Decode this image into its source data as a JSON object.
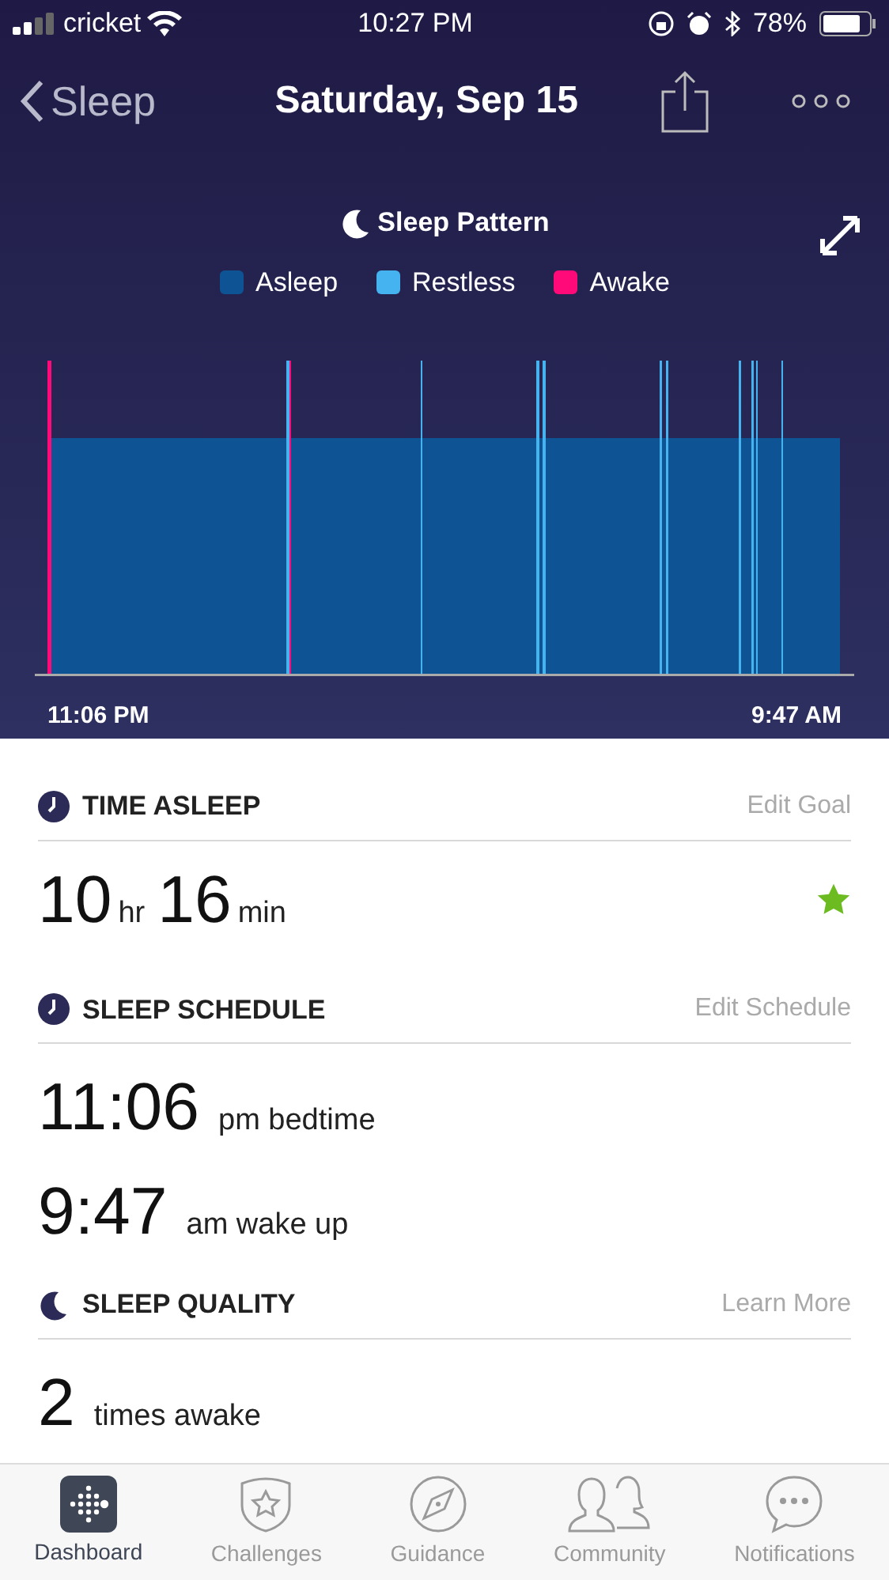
{
  "status_bar": {
    "carrier": "cricket",
    "time": "10:27 PM",
    "battery": "78%"
  },
  "nav": {
    "back": "Sleep",
    "title": "Saturday, Sep 15"
  },
  "chart": {
    "title": "Sleep Pattern",
    "start": "11:06 PM",
    "end": "9:47 AM",
    "legend": [
      {
        "label": "Asleep",
        "color": "#0e5394"
      },
      {
        "label": "Restless",
        "color": "#44b3f0"
      },
      {
        "label": "Awake",
        "color": "#ff0a78"
      }
    ]
  },
  "sections": [
    {
      "kind": "duration",
      "title": "TIME ASLEEP",
      "link": "Edit Goal",
      "goal_met": true,
      "values": [
        {
          "big": "10",
          "small": "hr"
        },
        {
          "big": "16",
          "small": "min"
        }
      ]
    },
    {
      "kind": "schedule",
      "title": "SLEEP SCHEDULE",
      "link": "Edit Schedule",
      "rows": [
        {
          "big": "11:06",
          "small": "pm bedtime"
        },
        {
          "big": "9:47",
          "small": "am wake up"
        }
      ]
    },
    {
      "kind": "quality",
      "title": "SLEEP QUALITY",
      "link": "Learn More",
      "rows": [
        {
          "big": "2",
          "small": "times awake"
        }
      ]
    }
  ],
  "tabs": [
    {
      "label": "Dashboard",
      "selected": true
    },
    {
      "label": "Challenges",
      "selected": false
    },
    {
      "label": "Guidance",
      "selected": false
    },
    {
      "label": "Community",
      "selected": false
    },
    {
      "label": "Notifications",
      "selected": false
    }
  ]
}
